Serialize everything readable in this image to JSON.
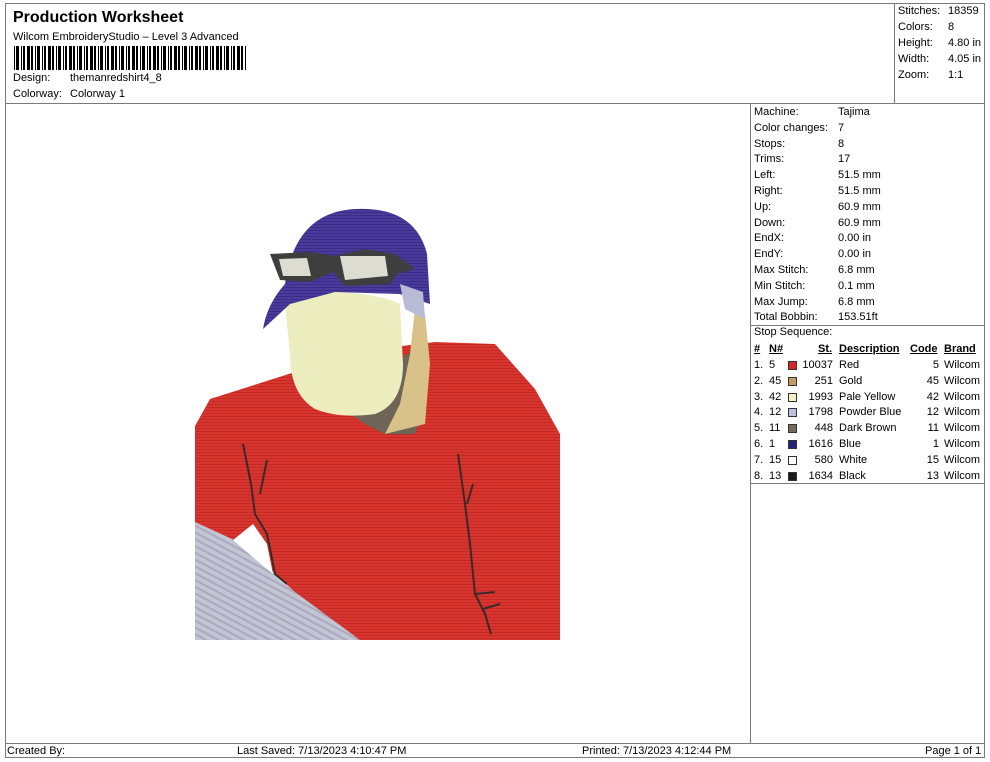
{
  "header": {
    "title": "Production Worksheet",
    "subtitle": "Wilcom EmbroideryStudio – Level 3 Advanced",
    "design_label": "Design:",
    "design_value": "themanredshirt4_8",
    "colorway_label": "Colorway:",
    "colorway_value": "Colorway 1"
  },
  "stats": [
    {
      "label": "Stitches:",
      "value": "18359"
    },
    {
      "label": "Colors:",
      "value": "8"
    },
    {
      "label": "Height:",
      "value": "4.80 in"
    },
    {
      "label": "Width:",
      "value": "4.05 in"
    },
    {
      "label": "Zoom:",
      "value": "1:1"
    }
  ],
  "machine_info": [
    {
      "label": "Machine:",
      "value": "Tajima"
    },
    {
      "label": "Color changes:",
      "value": "7"
    },
    {
      "label": "Stops:",
      "value": "8"
    },
    {
      "label": "Trims:",
      "value": "17"
    },
    {
      "label": "Left:",
      "value": "51.5 mm"
    },
    {
      "label": "Right:",
      "value": "51.5 mm"
    },
    {
      "label": "Up:",
      "value": "60.9 mm"
    },
    {
      "label": "Down:",
      "value": "60.9 mm"
    },
    {
      "label": "EndX:",
      "value": "0.00 in"
    },
    {
      "label": "EndY:",
      "value": "0.00 in"
    },
    {
      "label": "Max Stitch:",
      "value": "6.8 mm"
    },
    {
      "label": "Min Stitch:",
      "value": "0.1 mm"
    },
    {
      "label": "Max Jump:",
      "value": "6.8 mm"
    },
    {
      "label": "Total Bobbin:",
      "value": "153.51ft"
    }
  ],
  "stop_sequence": {
    "title": "Stop Sequence:",
    "headers": {
      "num": "#",
      "n": "N#",
      "st": "St.",
      "desc": "Description",
      "code": "Code",
      "brand": "Brand"
    },
    "rows": [
      {
        "idx": "1.",
        "n": "5",
        "st": "10037",
        "desc": "Red",
        "code": "5",
        "brand": "Wilcom",
        "color": "#d9262b"
      },
      {
        "idx": "2.",
        "n": "45",
        "st": "251",
        "desc": "Gold",
        "code": "45",
        "brand": "Wilcom",
        "color": "#c49a66"
      },
      {
        "idx": "3.",
        "n": "42",
        "st": "1993",
        "desc": "Pale Yellow",
        "code": "42",
        "brand": "Wilcom",
        "color": "#f2efc4"
      },
      {
        "idx": "4.",
        "n": "12",
        "st": "1798",
        "desc": "Powder Blue",
        "code": "12",
        "brand": "Wilcom",
        "color": "#bfc0dd"
      },
      {
        "idx": "5.",
        "n": "11",
        "st": "448",
        "desc": "Dark Brown",
        "code": "11",
        "brand": "Wilcom",
        "color": "#756a5e"
      },
      {
        "idx": "6.",
        "n": "1",
        "st": "1616",
        "desc": "Blue",
        "code": "1",
        "brand": "Wilcom",
        "color": "#241f7a"
      },
      {
        "idx": "7.",
        "n": "15",
        "st": "580",
        "desc": "White",
        "code": "15",
        "brand": "Wilcom",
        "color": "#ffffff"
      },
      {
        "idx": "8.",
        "n": "13",
        "st": "1634",
        "desc": "Black",
        "code": "13",
        "brand": "Wilcom",
        "color": "#1a1a1a"
      }
    ]
  },
  "footer": {
    "created_by": "Created By:",
    "last_saved": "Last Saved: 7/13/2023 4:10:47 PM",
    "printed": "Printed: 7/13/2023 4:12:44 PM",
    "page": "Page 1 of 1"
  }
}
